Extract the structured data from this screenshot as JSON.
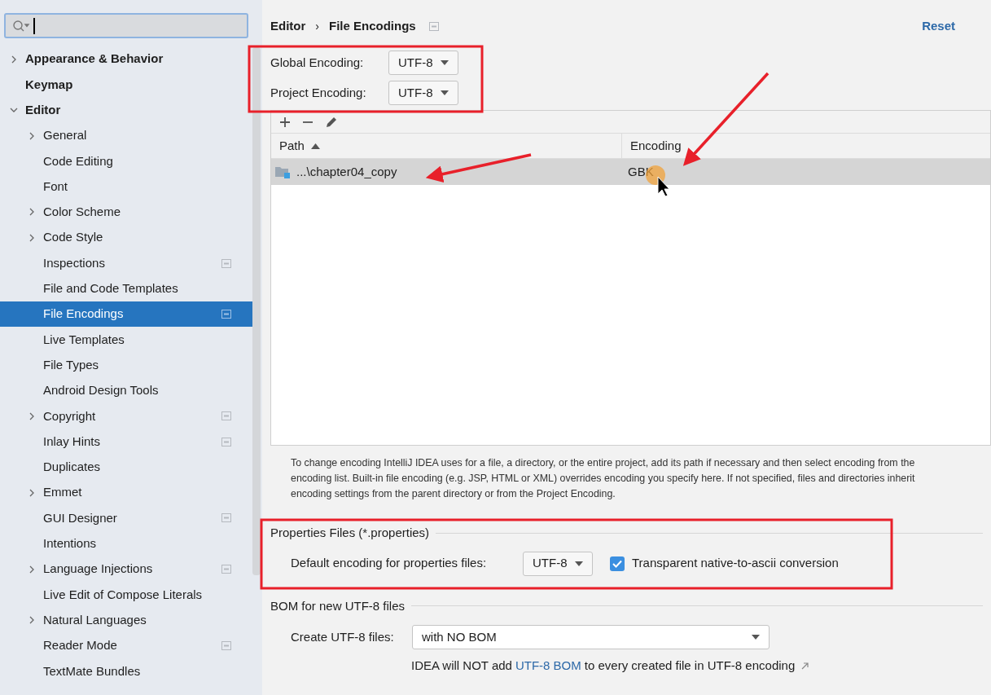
{
  "sidebar": {
    "items": [
      {
        "label": "Appearance & Behavior",
        "expanded": false
      },
      {
        "label": "Keymap"
      },
      {
        "label": "Editor",
        "expanded": true,
        "children": [
          {
            "label": "General",
            "expanded": false,
            "project_level": false,
            "selected": false
          },
          {
            "label": "Code Editing",
            "project_level": false,
            "selected": false
          },
          {
            "label": "Font",
            "project_level": false,
            "selected": false
          },
          {
            "label": "Color Scheme",
            "expanded": false,
            "project_level": false,
            "selected": false
          },
          {
            "label": "Code Style",
            "expanded": false,
            "project_level": false,
            "selected": false
          },
          {
            "label": "Inspections",
            "project_level": true,
            "selected": false
          },
          {
            "label": "File and Code Templates",
            "project_level": false,
            "selected": false
          },
          {
            "label": "File Encodings",
            "project_level": true,
            "selected": true
          },
          {
            "label": "Live Templates",
            "project_level": false,
            "selected": false
          },
          {
            "label": "File Types",
            "project_level": false,
            "selected": false
          },
          {
            "label": "Android Design Tools",
            "project_level": false,
            "selected": false
          },
          {
            "label": "Copyright",
            "expanded": false,
            "project_level": true,
            "selected": false
          },
          {
            "label": "Inlay Hints",
            "project_level": true,
            "selected": false
          },
          {
            "label": "Duplicates",
            "project_level": false,
            "selected": false
          },
          {
            "label": "Emmet",
            "expanded": false,
            "project_level": false,
            "selected": false
          },
          {
            "label": "GUI Designer",
            "project_level": true,
            "selected": false
          },
          {
            "label": "Intentions",
            "project_level": false,
            "selected": false
          },
          {
            "label": "Language Injections",
            "expanded": false,
            "project_level": true,
            "selected": false
          },
          {
            "label": "Live Edit of Compose Literals",
            "project_level": false,
            "selected": false
          },
          {
            "label": "Natural Languages",
            "expanded": false,
            "project_level": false,
            "selected": false
          },
          {
            "label": "Reader Mode",
            "project_level": true,
            "selected": false
          },
          {
            "label": "TextMate Bundles",
            "project_level": false,
            "selected": false
          }
        ]
      }
    ]
  },
  "breadcrumb": [
    "Editor",
    "File Encodings"
  ],
  "breadcrumb_separator": "›",
  "reset": "Reset",
  "encodings": [
    {
      "label": "Global Encoding:",
      "value": "UTF-8"
    },
    {
      "label": "Project Encoding:",
      "value": "UTF-8"
    }
  ],
  "table": {
    "columns": [
      {
        "label": "Path",
        "sorted": true
      },
      {
        "label": "Encoding",
        "sorted": false
      }
    ],
    "rows": [
      {
        "path": "...\\chapter04_copy",
        "encoding": "GBK",
        "selected": true
      }
    ]
  },
  "hint_lines": [
    "To change encoding IntelliJ IDEA uses for a file, a directory, or the entire project, add its path if necessary and then select encoding from the",
    "encoding list. Built-in file encoding (e.g. JSP, HTML or XML) overrides encoding you specify here. If not specified, files and directories inherit",
    "encoding settings from the parent directory or from the Project Encoding."
  ],
  "properties_section": {
    "title": "Properties Files (*.properties)",
    "label": "Default encoding for properties files:",
    "value": "UTF-8",
    "checkbox": {
      "label": "Transparent native-to-ascii conversion",
      "checked": true
    }
  },
  "bom_section": {
    "title": "BOM for new UTF-8 files",
    "label": "Create UTF-8 files:",
    "value": "with NO BOM",
    "note_before": "IDEA will NOT add",
    "note_link": "UTF-8 BOM",
    "note_after": "to every created file in UTF-8 encoding"
  }
}
